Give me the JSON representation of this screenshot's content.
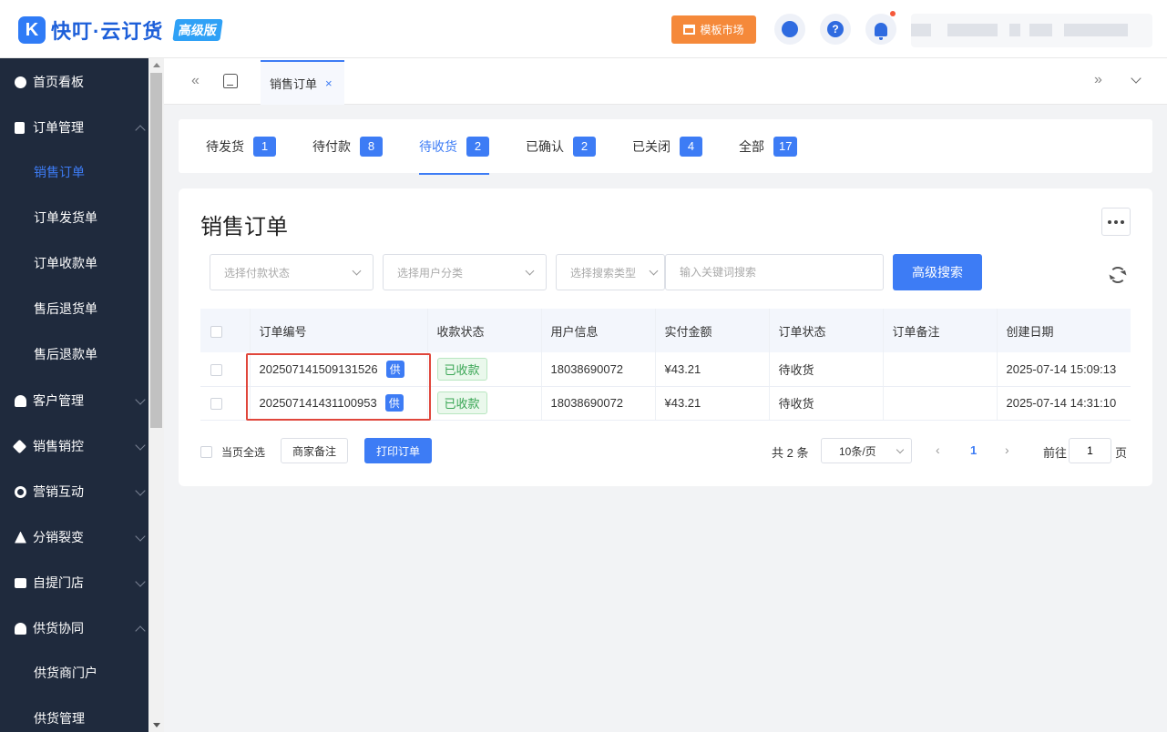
{
  "header": {
    "logo_mark": "K",
    "logo_text": "快叮·云订货",
    "edition_badge": "高级版",
    "template_market": "模板市场",
    "help_glyph": "?"
  },
  "sidebar": {
    "items": [
      {
        "label": "首页看板",
        "icon": "dashboard-icon"
      },
      {
        "label": "订单管理",
        "icon": "clipboard-icon"
      },
      {
        "label": "销售订单"
      },
      {
        "label": "订单发货单"
      },
      {
        "label": "订单收款单"
      },
      {
        "label": "售后退货单"
      },
      {
        "label": "售后退款单"
      },
      {
        "label": "客户管理",
        "icon": "user-icon"
      },
      {
        "label": "销售销控",
        "icon": "tag-icon"
      },
      {
        "label": "营销互动",
        "icon": "target-icon"
      },
      {
        "label": "分销裂变",
        "icon": "hierarchy-icon"
      },
      {
        "label": "自提门店",
        "icon": "store-icon"
      },
      {
        "label": "供货协同",
        "icon": "supplier-icon"
      },
      {
        "label": "供货商门户"
      },
      {
        "label": "供货管理"
      }
    ]
  },
  "tabbar": {
    "open_tab": "销售订单",
    "close_glyph": "×",
    "collapse_glyph": "«",
    "expand_glyph": "»"
  },
  "status_tabs": [
    {
      "label": "待发货",
      "count": "1"
    },
    {
      "label": "待付款",
      "count": "8"
    },
    {
      "label": "待收货",
      "count": "2"
    },
    {
      "label": "已确认",
      "count": "2"
    },
    {
      "label": "已关闭",
      "count": "4"
    },
    {
      "label": "全部",
      "count": "17"
    }
  ],
  "main": {
    "title": "销售订单",
    "filters": {
      "payment_status": "选择付款状态",
      "user_category": "选择用户分类",
      "search_type": "选择搜索类型",
      "keyword_placeholder": "输入关键词搜索",
      "advanced_search": "高级搜索"
    },
    "table": {
      "columns": [
        "订单编号",
        "收款状态",
        "用户信息",
        "实付金额",
        "订单状态",
        "订单备注",
        "创建日期"
      ],
      "rows": [
        {
          "order_no": "202507141509131526",
          "tag": "供",
          "pay_status": "已收款",
          "user": "18038690072",
          "amount": "¥43.21",
          "status": "待收货",
          "note": "",
          "created": "2025-07-14 15:09:13"
        },
        {
          "order_no": "202507141431100953",
          "tag": "供",
          "pay_status": "已收款",
          "user": "18038690072",
          "amount": "¥43.21",
          "status": "待收货",
          "note": "",
          "created": "2025-07-14 14:31:10"
        }
      ]
    },
    "footer": {
      "select_all": "当页全选",
      "merchant_note": "商家备注",
      "print_orders": "打印订单",
      "total": "共 2 条",
      "page_size": "10条/页",
      "current_page": "1",
      "goto_label": "前往",
      "goto_value": "1",
      "page_unit": "页"
    }
  }
}
